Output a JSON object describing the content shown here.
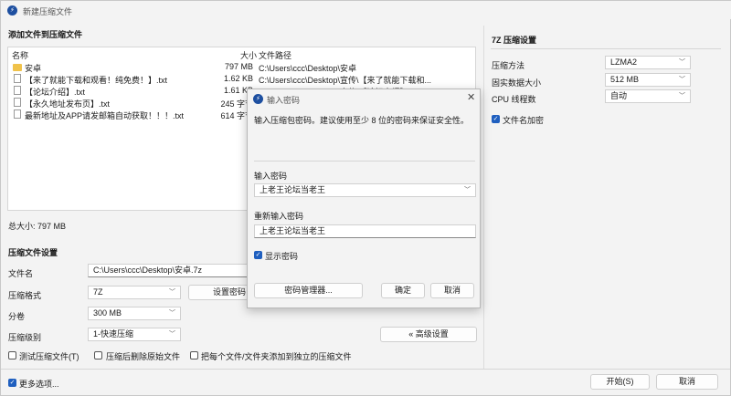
{
  "window": {
    "title": "新建压缩文件"
  },
  "files_section": {
    "heading": "添加文件到压缩文件",
    "columns": {
      "name": "名称",
      "size": "大小",
      "path": "文件路径"
    },
    "rows": [
      {
        "name": "安卓",
        "size": "797 MB",
        "path": "C:\\Users\\ccc\\Desktop\\安卓",
        "icon": "folder-icon"
      },
      {
        "name": "【来了就能下载和观看！纯免费！】.txt",
        "size": "1.62 KB",
        "path": "C:\\Users\\ccc\\Desktop\\宣传\\【来了就能下载和...",
        "icon": "file-icon"
      },
      {
        "name": "【论坛介绍】.txt",
        "size": "1.61 KB",
        "path": "C:\\Users\\ccc\\Desktop\\宣传\\【论坛介绍】.txt",
        "icon": "file-icon"
      },
      {
        "name": "【永久地址发布页】.txt",
        "size": "245 字节",
        "path": "",
        "icon": "file-icon"
      },
      {
        "name": "最新地址及APP请发邮箱自动获取！！！.txt",
        "size": "614 字节",
        "path": "",
        "icon": "file-icon"
      }
    ],
    "total_label": "总大小: 797 MB"
  },
  "archive_settings": {
    "heading": "压缩文件设置",
    "filename_label": "文件名",
    "filename_value": "C:\\Users\\ccc\\Desktop\\安卓.7z",
    "format_label": "压缩格式",
    "format_value": "7Z",
    "set_password_label": "设置密码(",
    "volume_label": "分卷",
    "volume_value": "300 MB",
    "level_label": "压缩级别",
    "level_value": "1-快速压缩",
    "advanced_label": "« 高级设置",
    "test_label": "测试压缩文件(T)",
    "delete_label": "压缩后删除原始文件",
    "separate_label": "把每个文件/文件夹添加到独立的压缩文件"
  },
  "sevenz_settings": {
    "heading": "7Z 压缩设置",
    "method_label": "压缩方法",
    "method_value": "LZMA2",
    "solid_label": "固实数据大小",
    "solid_value": "512 MB",
    "threads_label": "CPU 线程数",
    "threads_value": "自动",
    "encrypt_label": "文件名加密"
  },
  "footer": {
    "more_options_label": "更多选项...",
    "start_label": "开始(S)",
    "cancel_label": "取消"
  },
  "password_dialog": {
    "title": "输入密码",
    "hint": "输入压缩包密码。建议使用至少 8 位的密码来保证安全性。",
    "password_label": "输入密码",
    "password_value": "上老王论坛当老王",
    "confirm_label": "重新输入密码",
    "confirm_value": "上老王论坛当老王",
    "show_password_label": "显示密码",
    "manager_label": "密码管理器...",
    "ok_label": "确定",
    "cancel_label": "取消"
  },
  "colors": {
    "accent": "#1f5fbf",
    "background": "#f3f3f3"
  }
}
